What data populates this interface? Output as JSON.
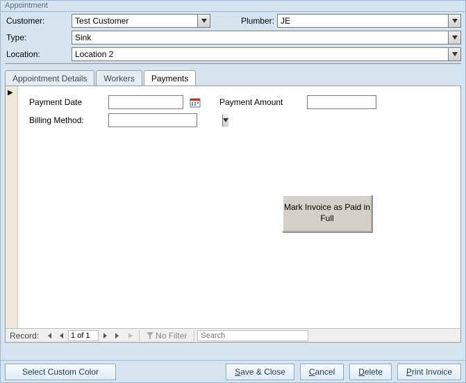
{
  "window": {
    "title": "Appointment"
  },
  "form": {
    "customer_label": "Customer:",
    "customer_value": "Test Customer",
    "plumber_label": "Plumber:",
    "plumber_value": "JE",
    "type_label": "Type:",
    "type_value": "Sink",
    "location_label": "Location:",
    "location_value": "Location 2"
  },
  "tabs": {
    "items": [
      {
        "label": "Appointment Details"
      },
      {
        "label": "Workers"
      },
      {
        "label": "Payments"
      }
    ]
  },
  "payments": {
    "payment_date_label": "Payment Date",
    "payment_date_value": "",
    "payment_amount_label": "Payment Amount",
    "payment_amount_value": "",
    "billing_method_label": "Billing Method:",
    "billing_method_value": "",
    "mark_paid_label": "Mark Invoice as Paid in Full"
  },
  "recordnav": {
    "label": "Record:",
    "position": "1 of 1",
    "filter_label": "No Filter",
    "search_placeholder": "Search"
  },
  "buttons": {
    "select_color": "Select Custom Color",
    "save_close": {
      "pre": "",
      "u": "S",
      "post": "ave & Close"
    },
    "cancel": {
      "pre": "",
      "u": "C",
      "post": "ancel"
    },
    "delete": {
      "pre": "",
      "u": "D",
      "post": "elete"
    },
    "print_invoice": {
      "pre": "",
      "u": "P",
      "post": "rint Invoice"
    }
  }
}
